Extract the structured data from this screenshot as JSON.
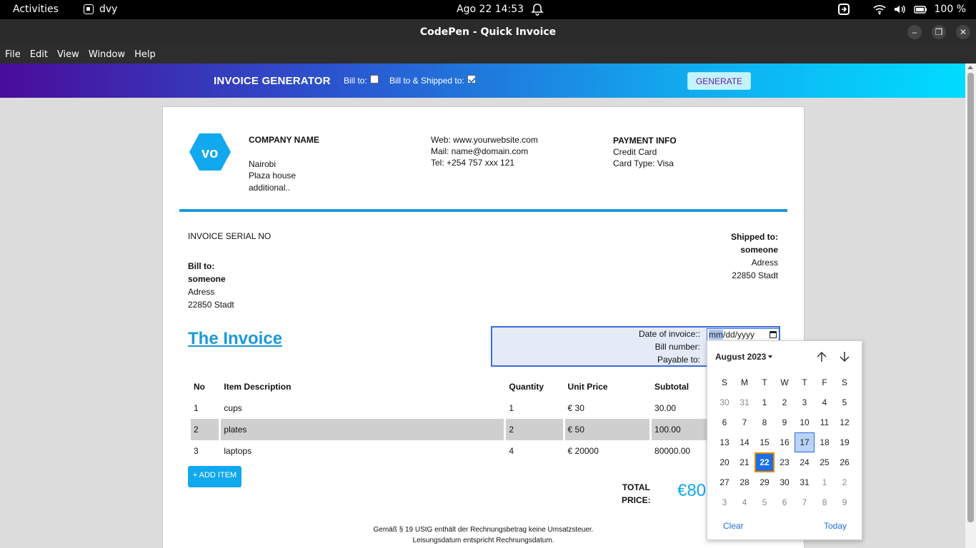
{
  "system": {
    "activities": "Activities",
    "app_name": "dvy",
    "clock": "Ago 22  14:53",
    "battery": "100 %"
  },
  "window": {
    "title": "CodePen - Quick Invoice",
    "minimize": "–",
    "maximize": "❐",
    "close": "✕"
  },
  "menu": [
    "File",
    "Edit",
    "View",
    "Window",
    "Help"
  ],
  "app": {
    "brand": "INVOICE GENERATOR",
    "bill_to_label": "Bill to:",
    "bill_ship_label": "Bill to & Shipped to:",
    "generate": "GENERATE"
  },
  "company": {
    "name": "COMPANY NAME",
    "line1": "Nairobi",
    "line2": "Plaza house",
    "line3": "additional.."
  },
  "contact": {
    "web": "Web: www.yourwebsite.com",
    "mail": "Mail: name@domain.com",
    "tel": "Tel: +254 757 xxx 121"
  },
  "payment": {
    "heading": "PAYMENT INFO",
    "method": "Credit Card",
    "card_type": "Card Type: Visa"
  },
  "invoice": {
    "serial": "INVOICE SERIAL NO",
    "bill_to_heading": "Bill to:",
    "bill_to_name": "someone",
    "bill_to_address": "Adress",
    "bill_to_city": "22850 Stadt",
    "ship_to_heading": "Shipped to:",
    "ship_to_name": "someone",
    "ship_to_address": "Adress",
    "ship_to_city": "22850 Stadt",
    "title": "The Invoice",
    "date_label": "Date of invoice::",
    "date_placeholder_a": "mm",
    "date_placeholder_b": "/dd/yyyy",
    "bill_number_label": "Bill number:",
    "payable_label": "Payable to:"
  },
  "table": {
    "headers": [
      "No",
      "Item Description",
      "Quantity",
      "Unit Price",
      "Subtotal"
    ],
    "rows": [
      {
        "no": "1",
        "desc": "cups",
        "qty": "1",
        "unit": "€ 30",
        "sub": "30.00"
      },
      {
        "no": "2",
        "desc": "plates",
        "qty": "2",
        "unit": "€ 50",
        "sub": "100.00"
      },
      {
        "no": "3",
        "desc": "laptops",
        "qty": "4",
        "unit": "€ 20000",
        "sub": "80000.00"
      }
    ]
  },
  "add_item": "+ ADD ITEM",
  "total": {
    "label_1": "TOTAL",
    "label_2": "PRICE:",
    "value": "€80"
  },
  "footer": {
    "line1": "Gemäß § 19 UStG enthält der Rechnungsbetrag keine Umsatzsteuer.",
    "line2": "Leisungsdatum entspricht Rechnungsdatum."
  },
  "datepicker": {
    "month": "August 2023",
    "weekdays": [
      "S",
      "M",
      "T",
      "W",
      "T",
      "F",
      "S"
    ],
    "weeks": [
      [
        {
          "d": "30",
          "m": 1
        },
        {
          "d": "31",
          "m": 1
        },
        {
          "d": "1"
        },
        {
          "d": "2"
        },
        {
          "d": "3"
        },
        {
          "d": "4"
        },
        {
          "d": "5"
        }
      ],
      [
        {
          "d": "6"
        },
        {
          "d": "7"
        },
        {
          "d": "8"
        },
        {
          "d": "9"
        },
        {
          "d": "10"
        },
        {
          "d": "11"
        },
        {
          "d": "12"
        }
      ],
      [
        {
          "d": "13"
        },
        {
          "d": "14"
        },
        {
          "d": "15"
        },
        {
          "d": "16"
        },
        {
          "d": "17",
          "h": 1
        },
        {
          "d": "18"
        },
        {
          "d": "19"
        }
      ],
      [
        {
          "d": "20"
        },
        {
          "d": "21"
        },
        {
          "d": "22",
          "t": 1
        },
        {
          "d": "23"
        },
        {
          "d": "24"
        },
        {
          "d": "25"
        },
        {
          "d": "26"
        }
      ],
      [
        {
          "d": "27"
        },
        {
          "d": "28"
        },
        {
          "d": "29"
        },
        {
          "d": "30"
        },
        {
          "d": "31"
        },
        {
          "d": "1",
          "m": 1
        },
        {
          "d": "2",
          "m": 1
        }
      ],
      [
        {
          "d": "3",
          "m": 1
        },
        {
          "d": "4",
          "m": 1
        },
        {
          "d": "5",
          "m": 1
        },
        {
          "d": "6",
          "m": 1
        },
        {
          "d": "7",
          "m": 1
        },
        {
          "d": "8",
          "m": 1
        },
        {
          "d": "9",
          "m": 1
        }
      ]
    ],
    "clear": "Clear",
    "today": "Today"
  }
}
